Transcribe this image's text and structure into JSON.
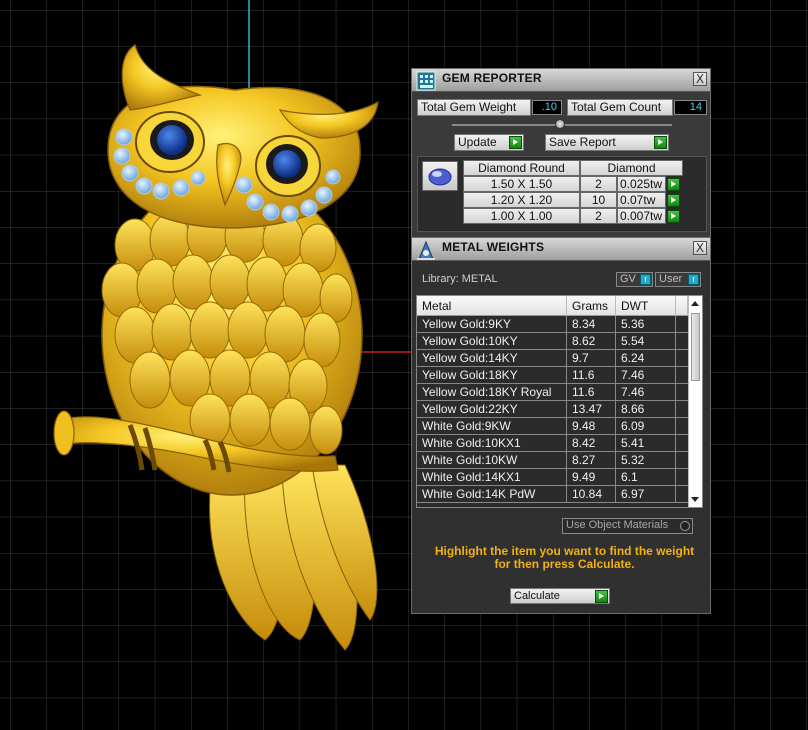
{
  "gem_reporter": {
    "title": "GEM REPORTER",
    "close_label": "X",
    "total_weight_label": "Total Gem Weight",
    "total_weight_value": ".10",
    "total_count_label": "Total Gem Count",
    "total_count_value": "14",
    "update_label": "Update",
    "save_report_label": "Save Report",
    "gem_header": {
      "shape": "Diamond Round",
      "type": "Diamond"
    },
    "gems": [
      {
        "size": "1.50 X 1.50",
        "count": "2",
        "weight": "0.025tw"
      },
      {
        "size": "1.20 X 1.20",
        "count": "10",
        "weight": "0.07tw"
      },
      {
        "size": "1.00 X 1.00",
        "count": "2",
        "weight": "0.007tw"
      }
    ]
  },
  "metal_weights": {
    "title": "METAL WEIGHTS",
    "close_label": "X",
    "library_label": "Library: METAL",
    "gv_label": "GV",
    "user_label": "User",
    "columns": [
      "Metal",
      "Grams",
      "DWT"
    ],
    "rows": [
      {
        "metal": "Yellow Gold:9KY",
        "grams": "8.34",
        "dwt": "5.36"
      },
      {
        "metal": "Yellow Gold:10KY",
        "grams": "8.62",
        "dwt": "5.54"
      },
      {
        "metal": "Yellow Gold:14KY",
        "grams": "9.7",
        "dwt": "6.24"
      },
      {
        "metal": "Yellow Gold:18KY",
        "grams": "11.6",
        "dwt": "7.46"
      },
      {
        "metal": "Yellow Gold:18KY Royal",
        "grams": "11.6",
        "dwt": "7.46"
      },
      {
        "metal": "Yellow Gold:22KY",
        "grams": "13.47",
        "dwt": "8.66"
      },
      {
        "metal": "White Gold:9KW",
        "grams": "9.48",
        "dwt": "6.09"
      },
      {
        "metal": "White Gold:10KX1",
        "grams": "8.42",
        "dwt": "5.41"
      },
      {
        "metal": "White Gold:10KW",
        "grams": "8.27",
        "dwt": "5.32"
      },
      {
        "metal": "White Gold:14KX1",
        "grams": "9.49",
        "dwt": "6.1"
      },
      {
        "metal": "White Gold:14K PdW",
        "grams": "10.84",
        "dwt": "6.97"
      }
    ],
    "use_object_materials_label": "Use Object Materials",
    "hint_line1": "Highlight the item you want to find the weight",
    "hint_line2": "for then press Calculate.",
    "calculate_label": "Calculate"
  },
  "colors": {
    "background": "#000000",
    "grid": "#3a3a3a",
    "gold": "#f2c21a",
    "gem_blue": "#1d4fb0",
    "accent_cyan": "#2aa6c9",
    "hint_text": "#f2b10f"
  }
}
